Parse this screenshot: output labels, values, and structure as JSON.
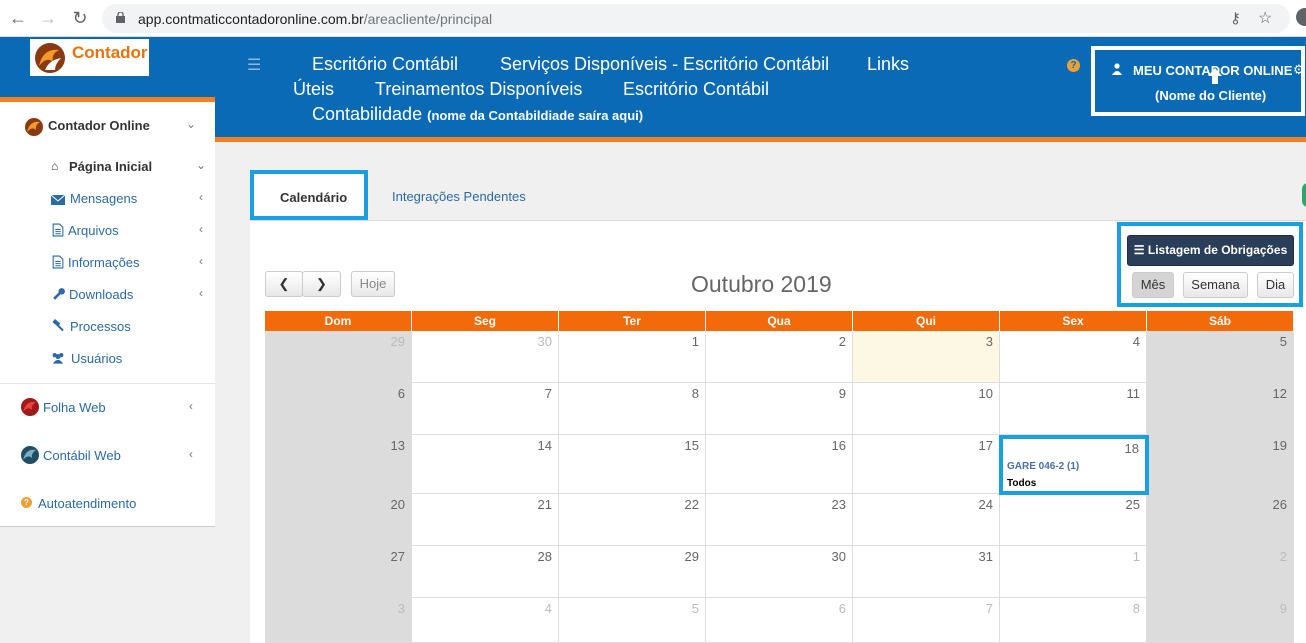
{
  "browser": {
    "url_host": "app.contmaticcontadoronline.com.br",
    "url_path": "/areacliente/principal"
  },
  "sidebar": {
    "logo_text": "Contador",
    "section_title": "Contador Online",
    "items": [
      {
        "label": "Página Inicial",
        "icon": "home-icon"
      },
      {
        "label": "Mensagens",
        "icon": "envelope-icon"
      },
      {
        "label": "Arquivos",
        "icon": "file-icon"
      },
      {
        "label": "Informações",
        "icon": "file-icon"
      },
      {
        "label": "Downloads",
        "icon": "wrench-icon"
      },
      {
        "label": "Processos",
        "icon": "gavel-icon"
      },
      {
        "label": "Usuários",
        "icon": "users-icon"
      }
    ],
    "apps": [
      {
        "label": "Folha Web"
      },
      {
        "label": "Contábil Web"
      },
      {
        "label": "Autoatendimento"
      }
    ]
  },
  "header": {
    "links": [
      "Escritório Contábil",
      "Serviços Disponíveis - Escritório Contábil",
      "Links",
      "Úteis",
      "Treinamentos Disponíveis",
      "Escritório Contábil",
      "Contabilidade"
    ],
    "note": "(nome da Contabildiade saíra aqui)",
    "user_title": "MEU CONTADOR ONLINE",
    "user_name": "(Nome do Cliente)"
  },
  "tabs": [
    "Calendário",
    "Integrações Pendentes"
  ],
  "calendar": {
    "title": "Outubro 2019",
    "btn_obrigacoes": "Listagem de Obrigações",
    "btn_mes": "Mês",
    "btn_semana": "Semana",
    "btn_dia": "Dia",
    "btn_hoje": "Hoje",
    "days": [
      "Dom",
      "Seg",
      "Ter",
      "Qua",
      "Qui",
      "Sex",
      "Sáb"
    ],
    "weeks": [
      [
        29,
        30,
        1,
        2,
        3,
        4,
        5
      ],
      [
        6,
        7,
        8,
        9,
        10,
        11,
        12
      ],
      [
        13,
        14,
        15,
        16,
        17,
        18,
        19
      ],
      [
        20,
        21,
        22,
        23,
        24,
        25,
        26
      ],
      [
        27,
        28,
        29,
        30,
        31,
        1,
        2
      ],
      [
        3,
        4,
        5,
        6,
        7,
        8,
        9
      ]
    ],
    "event": {
      "day": "18",
      "title": "GARE 046-2 (1)",
      "sub": "Todos"
    },
    "colors": {
      "header": "#f26a0a",
      "today": "#fcf8e3",
      "weekend": "#dcdcdc",
      "highlight": "#1aa0e0"
    }
  }
}
